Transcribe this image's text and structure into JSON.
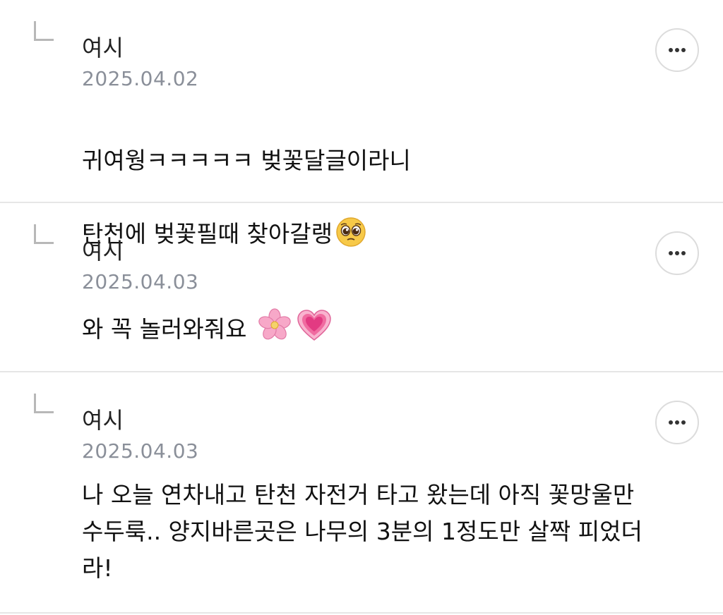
{
  "comments": [
    {
      "author": "여시",
      "date": "2025.04.02",
      "text_line1": "귀여웡ㅋㅋㅋㅋㅋ 벚꽃달글이라니",
      "text_line2": "탄천에 벚꽃필때 찾아갈랭",
      "emojis": [
        "pleading-face"
      ]
    },
    {
      "author": "여시",
      "date": "2025.04.03",
      "text_line1": "와 꼭 놀러와줘요",
      "emojis": [
        "cherry-blossom",
        "growing-heart"
      ]
    },
    {
      "author": "여시",
      "date": "2025.04.03",
      "text": "나 오늘 연차내고 탄천 자전거 타고 왔는데 아직 꽃망울만\n수두룩.. 양지바른곳은 나무의 3분의 1정도만 살짝 피었더\n라!"
    }
  ],
  "icons": {
    "reply": "reply-arrow-icon",
    "more": "more-horizontal-icon"
  },
  "colors": {
    "date": "#8a8f99",
    "divider": "#e6e6e6",
    "icon": "#b8b8b8"
  }
}
